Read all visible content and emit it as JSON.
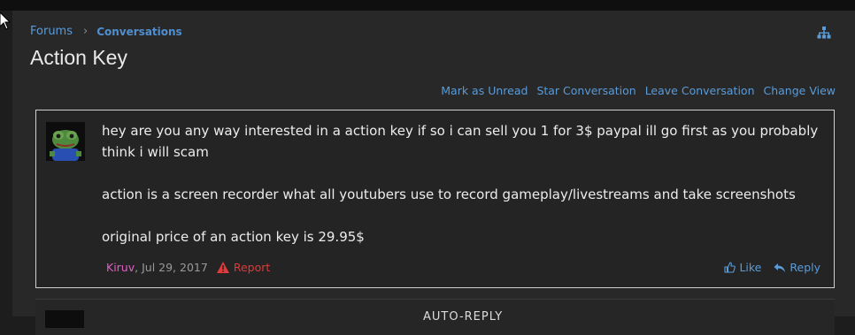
{
  "breadcrumb": {
    "parent": "Forums",
    "current": "Conversations"
  },
  "page": {
    "title": "Action Key"
  },
  "conversation_actions": {
    "mark_unread": "Mark as Unread",
    "star": "Star Conversation",
    "leave": "Leave Conversation",
    "change_view": "Change View"
  },
  "message": {
    "paragraphs": [
      "hey are you any way interested in a action key if so i can sell you 1 for 3$ paypal ill go first as you probably think i will scam",
      "action is a screen recorder what all youtubers use to record gameplay/livestreams and take screenshots",
      "original price of an action key is 29.95$"
    ],
    "author": "Kiruv",
    "date": "Jul 29, 2017",
    "report": "Report",
    "like": "Like",
    "reply": "Reply"
  },
  "next_message": {
    "preview": "AUTO-REPLY"
  },
  "colors": {
    "link": "#5a9bd8",
    "author": "#e05fc4",
    "report": "#e03a3a",
    "panel": "#282828"
  },
  "icons": [
    "cursor-icon",
    "sitemap-icon",
    "avatar-frog",
    "warning-icon",
    "thumbs-up-icon",
    "reply-icon"
  ]
}
